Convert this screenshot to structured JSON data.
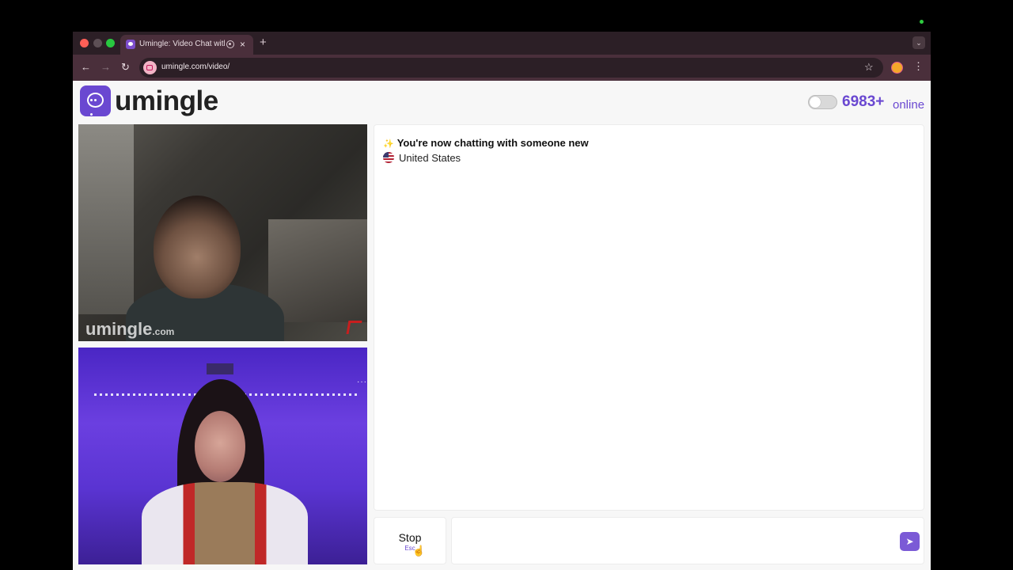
{
  "browser": {
    "tab_title": "Umingle: Video Chat with",
    "tab_close": "×",
    "new_tab": "+",
    "url": "umingle.com/video/"
  },
  "site": {
    "logo_text": "umingle",
    "online_count": "6983+",
    "online_label": "online",
    "watermark_main": "umingle",
    "watermark_suffix": ".com",
    "accent_color": "#6a48d1"
  },
  "chat": {
    "status_message": "You're now chatting with someone new",
    "country": "United States",
    "message_placeholder": ""
  },
  "controls": {
    "stop_label": "Stop",
    "stop_hint": "Esc"
  }
}
